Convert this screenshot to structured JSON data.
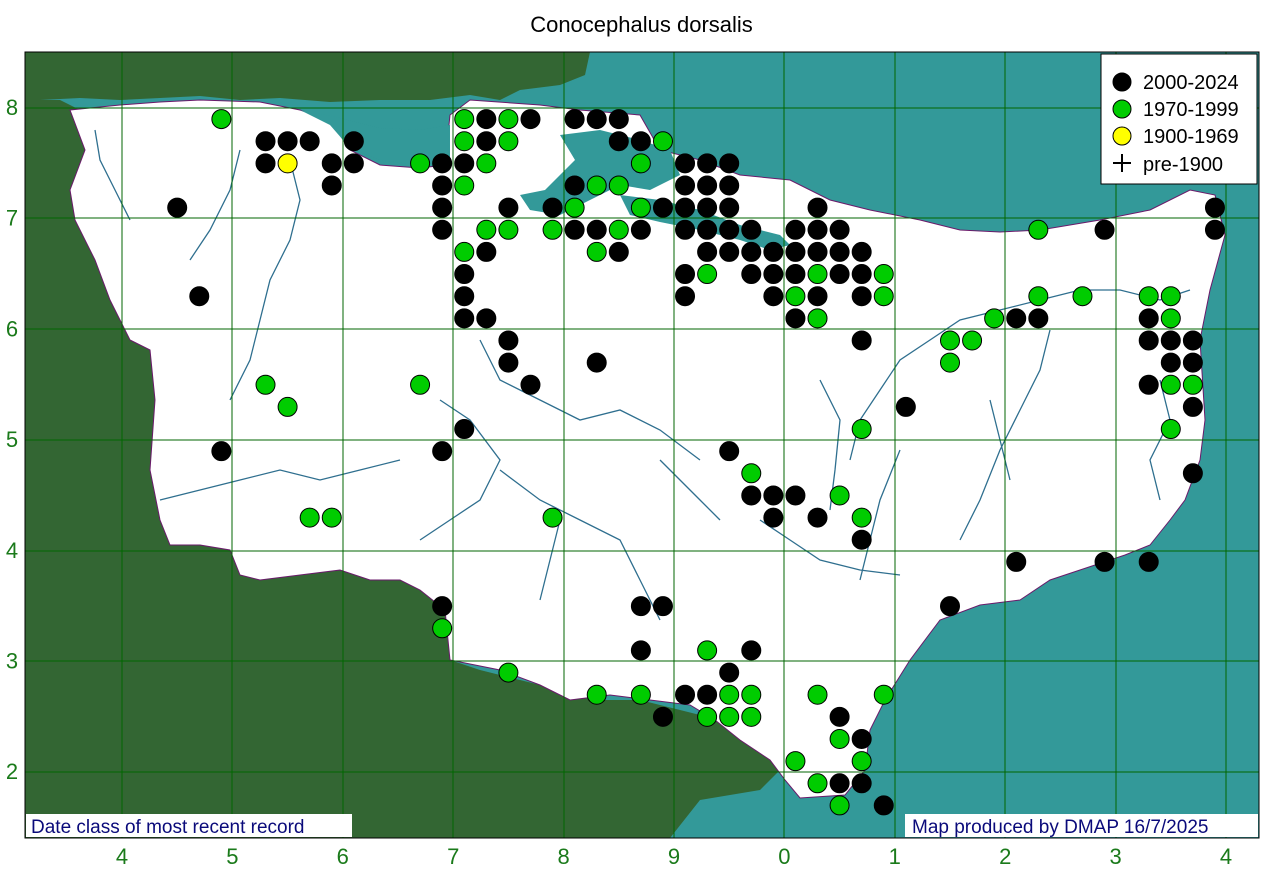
{
  "title": "Conocephalus dorsalis",
  "colors": {
    "sea": "#339999",
    "outside_land": "#336633",
    "county": "#ffffff",
    "grid": "#006600",
    "rivers": "#2f6f8f",
    "recent": "#000000",
    "mid": "#00cc00",
    "old": "#ffff00",
    "axis_text": "#1a7a1a",
    "footer_text": "#0a0a7a"
  },
  "legend": {
    "items": [
      {
        "label": "2000-2024",
        "symbol": "black-circle"
      },
      {
        "label": "1970-1999",
        "symbol": "green-circle"
      },
      {
        "label": "1900-1969",
        "symbol": "yellow-circle"
      },
      {
        "label": "pre-1900",
        "symbol": "plus"
      }
    ]
  },
  "footer": {
    "left": "Date class of most recent record",
    "right": "Map produced by DMAP 16/7/2025"
  },
  "x_ticks": [
    "4",
    "5",
    "6",
    "7",
    "8",
    "9",
    "0",
    "1",
    "2",
    "3",
    "4"
  ],
  "y_ticks": [
    "8",
    "7",
    "6",
    "5",
    "4",
    "3",
    "2"
  ],
  "records": [
    {
      "x": 4.5,
      "y": 7.1,
      "c": "r"
    },
    {
      "x": 4.7,
      "y": 6.3,
      "c": "r"
    },
    {
      "x": 4.9,
      "y": 7.9,
      "c": "g"
    },
    {
      "x": 4.9,
      "y": 4.9,
      "c": "r"
    },
    {
      "x": 5.3,
      "y": 7.7,
      "c": "r"
    },
    {
      "x": 5.3,
      "y": 7.5,
      "c": "r"
    },
    {
      "x": 5.5,
      "y": 7.7,
      "c": "r"
    },
    {
      "x": 5.5,
      "y": 7.5,
      "c": "y"
    },
    {
      "x": 5.7,
      "y": 7.7,
      "c": "r"
    },
    {
      "x": 5.9,
      "y": 7.5,
      "c": "r"
    },
    {
      "x": 5.9,
      "y": 7.3,
      "c": "r"
    },
    {
      "x": 6.1,
      "y": 7.7,
      "c": "r"
    },
    {
      "x": 6.1,
      "y": 7.5,
      "c": "r"
    },
    {
      "x": 5.3,
      "y": 5.5,
      "c": "g"
    },
    {
      "x": 5.5,
      "y": 5.3,
      "c": "g"
    },
    {
      "x": 5.7,
      "y": 4.3,
      "c": "g"
    },
    {
      "x": 5.9,
      "y": 4.3,
      "c": "g"
    },
    {
      "x": 6.7,
      "y": 7.5,
      "c": "g"
    },
    {
      "x": 6.7,
      "y": 5.5,
      "c": "g"
    },
    {
      "x": 6.9,
      "y": 7.5,
      "c": "r"
    },
    {
      "x": 6.9,
      "y": 7.3,
      "c": "r"
    },
    {
      "x": 6.9,
      "y": 7.1,
      "c": "r"
    },
    {
      "x": 6.9,
      "y": 6.9,
      "c": "r"
    },
    {
      "x": 6.9,
      "y": 4.9,
      "c": "r"
    },
    {
      "x": 6.9,
      "y": 3.5,
      "c": "r"
    },
    {
      "x": 6.9,
      "y": 3.3,
      "c": "g"
    },
    {
      "x": 7.1,
      "y": 7.9,
      "c": "g"
    },
    {
      "x": 7.1,
      "y": 7.7,
      "c": "g"
    },
    {
      "x": 7.1,
      "y": 7.5,
      "c": "r"
    },
    {
      "x": 7.1,
      "y": 7.3,
      "c": "g"
    },
    {
      "x": 7.1,
      "y": 6.7,
      "c": "g"
    },
    {
      "x": 7.1,
      "y": 6.5,
      "c": "r"
    },
    {
      "x": 7.1,
      "y": 6.3,
      "c": "r"
    },
    {
      "x": 7.1,
      "y": 6.1,
      "c": "r"
    },
    {
      "x": 7.1,
      "y": 5.1,
      "c": "r"
    },
    {
      "x": 7.3,
      "y": 7.9,
      "c": "r"
    },
    {
      "x": 7.3,
      "y": 7.7,
      "c": "r"
    },
    {
      "x": 7.3,
      "y": 7.5,
      "c": "g"
    },
    {
      "x": 7.3,
      "y": 6.9,
      "c": "g"
    },
    {
      "x": 7.3,
      "y": 6.7,
      "c": "r"
    },
    {
      "x": 7.3,
      "y": 6.1,
      "c": "r"
    },
    {
      "x": 7.5,
      "y": 7.9,
      "c": "g"
    },
    {
      "x": 7.5,
      "y": 7.7,
      "c": "g"
    },
    {
      "x": 7.5,
      "y": 7.1,
      "c": "r"
    },
    {
      "x": 7.5,
      "y": 6.9,
      "c": "g"
    },
    {
      "x": 7.5,
      "y": 5.9,
      "c": "r"
    },
    {
      "x": 7.5,
      "y": 5.7,
      "c": "r"
    },
    {
      "x": 7.5,
      "y": 2.9,
      "c": "g"
    },
    {
      "x": 7.7,
      "y": 7.9,
      "c": "r"
    },
    {
      "x": 7.7,
      "y": 5.5,
      "c": "r"
    },
    {
      "x": 7.9,
      "y": 7.1,
      "c": "r"
    },
    {
      "x": 7.9,
      "y": 6.9,
      "c": "g"
    },
    {
      "x": 7.9,
      "y": 4.3,
      "c": "g"
    },
    {
      "x": 8.1,
      "y": 7.9,
      "c": "r"
    },
    {
      "x": 8.1,
      "y": 7.3,
      "c": "r"
    },
    {
      "x": 8.1,
      "y": 7.1,
      "c": "g"
    },
    {
      "x": 8.1,
      "y": 6.9,
      "c": "r"
    },
    {
      "x": 8.3,
      "y": 7.9,
      "c": "r"
    },
    {
      "x": 8.3,
      "y": 7.3,
      "c": "g"
    },
    {
      "x": 8.3,
      "y": 6.9,
      "c": "r"
    },
    {
      "x": 8.3,
      "y": 6.7,
      "c": "g"
    },
    {
      "x": 8.3,
      "y": 5.7,
      "c": "r"
    },
    {
      "x": 8.3,
      "y": 2.7,
      "c": "g"
    },
    {
      "x": 8.5,
      "y": 7.9,
      "c": "r"
    },
    {
      "x": 8.5,
      "y": 7.7,
      "c": "r"
    },
    {
      "x": 8.5,
      "y": 7.3,
      "c": "g"
    },
    {
      "x": 8.5,
      "y": 6.9,
      "c": "g"
    },
    {
      "x": 8.5,
      "y": 6.7,
      "c": "r"
    },
    {
      "x": 8.7,
      "y": 7.7,
      "c": "r"
    },
    {
      "x": 8.7,
      "y": 7.5,
      "c": "g"
    },
    {
      "x": 8.7,
      "y": 7.1,
      "c": "g"
    },
    {
      "x": 8.7,
      "y": 6.9,
      "c": "r"
    },
    {
      "x": 8.7,
      "y": 3.5,
      "c": "r"
    },
    {
      "x": 8.7,
      "y": 3.1,
      "c": "r"
    },
    {
      "x": 8.7,
      "y": 2.7,
      "c": "g"
    },
    {
      "x": 8.9,
      "y": 7.7,
      "c": "g"
    },
    {
      "x": 8.9,
      "y": 7.1,
      "c": "r"
    },
    {
      "x": 8.9,
      "y": 3.5,
      "c": "r"
    },
    {
      "x": 8.9,
      "y": 2.5,
      "c": "r"
    },
    {
      "x": 9.1,
      "y": 7.5,
      "c": "r"
    },
    {
      "x": 9.1,
      "y": 7.3,
      "c": "r"
    },
    {
      "x": 9.1,
      "y": 7.1,
      "c": "r"
    },
    {
      "x": 9.1,
      "y": 6.9,
      "c": "r"
    },
    {
      "x": 9.1,
      "y": 6.5,
      "c": "r"
    },
    {
      "x": 9.1,
      "y": 6.3,
      "c": "r"
    },
    {
      "x": 9.1,
      "y": 2.7,
      "c": "r"
    },
    {
      "x": 9.3,
      "y": 7.5,
      "c": "r"
    },
    {
      "x": 9.3,
      "y": 7.3,
      "c": "r"
    },
    {
      "x": 9.3,
      "y": 7.1,
      "c": "r"
    },
    {
      "x": 9.3,
      "y": 6.9,
      "c": "r"
    },
    {
      "x": 9.3,
      "y": 6.7,
      "c": "r"
    },
    {
      "x": 9.3,
      "y": 6.5,
      "c": "g"
    },
    {
      "x": 9.3,
      "y": 3.1,
      "c": "g"
    },
    {
      "x": 9.3,
      "y": 2.7,
      "c": "r"
    },
    {
      "x": 9.3,
      "y": 2.5,
      "c": "g"
    },
    {
      "x": 9.5,
      "y": 7.5,
      "c": "r"
    },
    {
      "x": 9.5,
      "y": 7.3,
      "c": "r"
    },
    {
      "x": 9.5,
      "y": 7.1,
      "c": "r"
    },
    {
      "x": 9.5,
      "y": 6.9,
      "c": "r"
    },
    {
      "x": 9.5,
      "y": 6.7,
      "c": "r"
    },
    {
      "x": 9.5,
      "y": 4.9,
      "c": "r"
    },
    {
      "x": 9.5,
      "y": 2.9,
      "c": "r"
    },
    {
      "x": 9.5,
      "y": 2.7,
      "c": "g"
    },
    {
      "x": 9.5,
      "y": 2.5,
      "c": "g"
    },
    {
      "x": 9.7,
      "y": 6.9,
      "c": "r"
    },
    {
      "x": 9.7,
      "y": 6.7,
      "c": "r"
    },
    {
      "x": 9.7,
      "y": 6.5,
      "c": "r"
    },
    {
      "x": 9.7,
      "y": 4.7,
      "c": "g"
    },
    {
      "x": 9.7,
      "y": 4.5,
      "c": "r"
    },
    {
      "x": 9.7,
      "y": 3.1,
      "c": "r"
    },
    {
      "x": 9.7,
      "y": 2.7,
      "c": "g"
    },
    {
      "x": 9.7,
      "y": 2.5,
      "c": "g"
    },
    {
      "x": 9.9,
      "y": 6.7,
      "c": "r"
    },
    {
      "x": 9.9,
      "y": 6.5,
      "c": "r"
    },
    {
      "x": 9.9,
      "y": 6.3,
      "c": "r"
    },
    {
      "x": 9.9,
      "y": 4.5,
      "c": "r"
    },
    {
      "x": 9.9,
      "y": 4.3,
      "c": "r"
    },
    {
      "x": 10.1,
      "y": 6.9,
      "c": "r"
    },
    {
      "x": 10.1,
      "y": 6.7,
      "c": "r"
    },
    {
      "x": 10.1,
      "y": 6.5,
      "c": "r"
    },
    {
      "x": 10.1,
      "y": 6.3,
      "c": "g"
    },
    {
      "x": 10.1,
      "y": 6.1,
      "c": "r"
    },
    {
      "x": 10.1,
      "y": 4.5,
      "c": "r"
    },
    {
      "x": 10.1,
      "y": 2.1,
      "c": "g"
    },
    {
      "x": 10.3,
      "y": 7.1,
      "c": "r"
    },
    {
      "x": 10.3,
      "y": 6.9,
      "c": "r"
    },
    {
      "x": 10.3,
      "y": 6.7,
      "c": "r"
    },
    {
      "x": 10.3,
      "y": 6.5,
      "c": "g"
    },
    {
      "x": 10.3,
      "y": 6.3,
      "c": "r"
    },
    {
      "x": 10.3,
      "y": 6.1,
      "c": "g"
    },
    {
      "x": 10.3,
      "y": 4.3,
      "c": "r"
    },
    {
      "x": 10.3,
      "y": 2.7,
      "c": "g"
    },
    {
      "x": 10.3,
      "y": 1.9,
      "c": "g"
    },
    {
      "x": 10.5,
      "y": 6.9,
      "c": "r"
    },
    {
      "x": 10.5,
      "y": 6.7,
      "c": "r"
    },
    {
      "x": 10.5,
      "y": 6.5,
      "c": "r"
    },
    {
      "x": 10.5,
      "y": 4.5,
      "c": "g"
    },
    {
      "x": 10.5,
      "y": 2.5,
      "c": "r"
    },
    {
      "x": 10.5,
      "y": 2.3,
      "c": "g"
    },
    {
      "x": 10.5,
      "y": 1.9,
      "c": "r"
    },
    {
      "x": 10.5,
      "y": 1.7,
      "c": "g"
    },
    {
      "x": 10.7,
      "y": 6.7,
      "c": "r"
    },
    {
      "x": 10.7,
      "y": 6.5,
      "c": "r"
    },
    {
      "x": 10.7,
      "y": 6.3,
      "c": "r"
    },
    {
      "x": 10.7,
      "y": 5.9,
      "c": "r"
    },
    {
      "x": 10.7,
      "y": 5.1,
      "c": "g"
    },
    {
      "x": 10.7,
      "y": 4.3,
      "c": "g"
    },
    {
      "x": 10.7,
      "y": 4.1,
      "c": "r"
    },
    {
      "x": 10.7,
      "y": 2.3,
      "c": "r"
    },
    {
      "x": 10.7,
      "y": 2.1,
      "c": "g"
    },
    {
      "x": 10.7,
      "y": 1.9,
      "c": "r"
    },
    {
      "x": 10.9,
      "y": 6.5,
      "c": "g"
    },
    {
      "x": 10.9,
      "y": 6.3,
      "c": "g"
    },
    {
      "x": 10.9,
      "y": 2.7,
      "c": "g"
    },
    {
      "x": 10.9,
      "y": 1.7,
      "c": "r"
    },
    {
      "x": 11.1,
      "y": 5.3,
      "c": "r"
    },
    {
      "x": 11.5,
      "y": 5.9,
      "c": "g"
    },
    {
      "x": 11.5,
      "y": 5.7,
      "c": "g"
    },
    {
      "x": 11.5,
      "y": 3.5,
      "c": "r"
    },
    {
      "x": 11.7,
      "y": 5.9,
      "c": "g"
    },
    {
      "x": 11.9,
      "y": 6.1,
      "c": "g"
    },
    {
      "x": 12.1,
      "y": 6.1,
      "c": "r"
    },
    {
      "x": 12.1,
      "y": 3.9,
      "c": "r"
    },
    {
      "x": 12.3,
      "y": 6.9,
      "c": "g"
    },
    {
      "x": 12.3,
      "y": 6.3,
      "c": "g"
    },
    {
      "x": 12.3,
      "y": 6.1,
      "c": "r"
    },
    {
      "x": 12.7,
      "y": 6.3,
      "c": "g"
    },
    {
      "x": 12.9,
      "y": 6.9,
      "c": "r"
    },
    {
      "x": 12.9,
      "y": 3.9,
      "c": "r"
    },
    {
      "x": 13.3,
      "y": 6.3,
      "c": "g"
    },
    {
      "x": 13.3,
      "y": 6.1,
      "c": "r"
    },
    {
      "x": 13.3,
      "y": 5.9,
      "c": "r"
    },
    {
      "x": 13.3,
      "y": 5.5,
      "c": "r"
    },
    {
      "x": 13.3,
      "y": 3.9,
      "c": "r"
    },
    {
      "x": 13.5,
      "y": 6.3,
      "c": "g"
    },
    {
      "x": 13.5,
      "y": 6.1,
      "c": "g"
    },
    {
      "x": 13.5,
      "y": 5.9,
      "c": "r"
    },
    {
      "x": 13.5,
      "y": 5.7,
      "c": "r"
    },
    {
      "x": 13.5,
      "y": 5.5,
      "c": "g"
    },
    {
      "x": 13.5,
      "y": 5.1,
      "c": "g"
    },
    {
      "x": 13.7,
      "y": 5.9,
      "c": "r"
    },
    {
      "x": 13.7,
      "y": 5.7,
      "c": "r"
    },
    {
      "x": 13.7,
      "y": 5.5,
      "c": "g"
    },
    {
      "x": 13.7,
      "y": 5.3,
      "c": "r"
    },
    {
      "x": 13.7,
      "y": 4.7,
      "c": "r"
    },
    {
      "x": 13.9,
      "y": 7.1,
      "c": "r"
    },
    {
      "x": 13.9,
      "y": 6.9,
      "c": "r"
    }
  ]
}
